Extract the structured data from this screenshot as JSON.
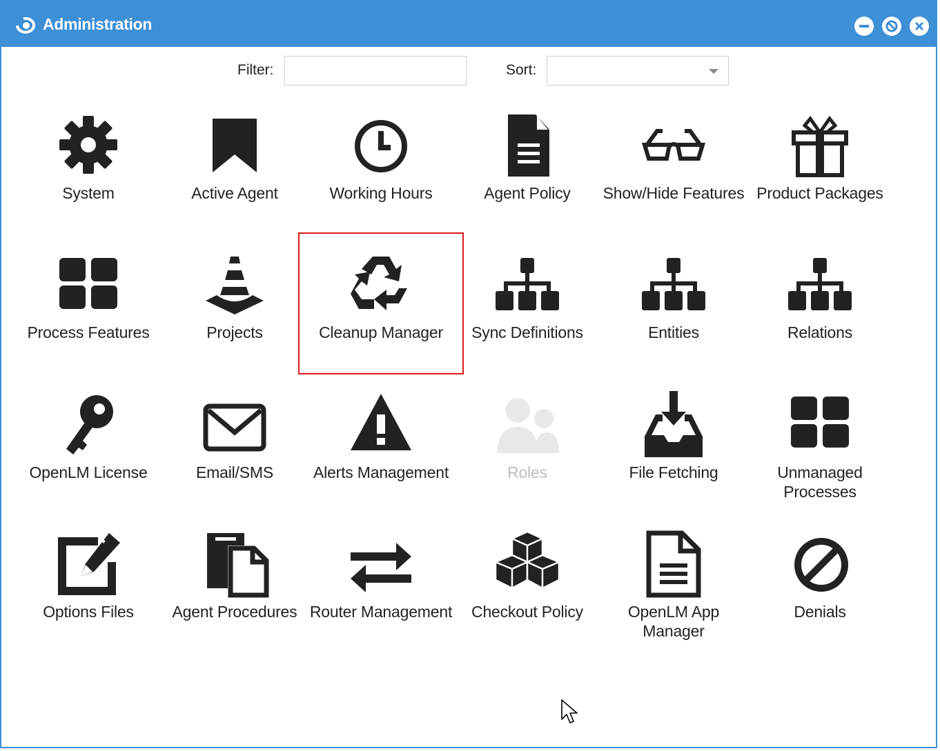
{
  "window": {
    "title": "Administration",
    "accent_color": "#3d8fd6",
    "controls": [
      "minimize-icon",
      "restore-icon",
      "close-icon"
    ]
  },
  "toolbar": {
    "filter_label": "Filter:",
    "filter_value": "",
    "sort_label": "Sort:",
    "sort_value": ""
  },
  "tiles": [
    {
      "label": "System",
      "icon": "gear-icon"
    },
    {
      "label": "Active Agent",
      "icon": "bookmark-icon"
    },
    {
      "label": "Working Hours",
      "icon": "clock-icon"
    },
    {
      "label": "Agent Policy",
      "icon": "document-icon"
    },
    {
      "label": "Show/Hide Features",
      "icon": "glasses-icon"
    },
    {
      "label": "Product Packages",
      "icon": "gift-icon"
    },
    {
      "label": "Process Features",
      "icon": "grid-icon"
    },
    {
      "label": "Projects",
      "icon": "traffic-cone-icon"
    },
    {
      "label": "Cleanup Manager",
      "icon": "recycle-icon",
      "highlighted": true
    },
    {
      "label": "Sync Definitions",
      "icon": "sitemap-icon"
    },
    {
      "label": "Entities",
      "icon": "sitemap-icon"
    },
    {
      "label": "Relations",
      "icon": "sitemap-icon"
    },
    {
      "label": "OpenLM License",
      "icon": "key-icon"
    },
    {
      "label": "Email/SMS",
      "icon": "envelope-icon"
    },
    {
      "label": "Alerts Management",
      "icon": "warning-icon"
    },
    {
      "label": "Roles",
      "icon": "users-icon",
      "disabled": true
    },
    {
      "label": "File Fetching",
      "icon": "download-tray-icon"
    },
    {
      "label": "Unmanaged Processes",
      "icon": "grid-icon"
    },
    {
      "label": "Options Files",
      "icon": "edit-icon"
    },
    {
      "label": "Agent Procedures",
      "icon": "copy-icon"
    },
    {
      "label": "Router Management",
      "icon": "exchange-icon"
    },
    {
      "label": "Checkout Policy",
      "icon": "cubes-icon"
    },
    {
      "label": "OpenLM App Manager",
      "icon": "file-text-icon"
    },
    {
      "label": "Denials",
      "icon": "ban-icon"
    }
  ]
}
